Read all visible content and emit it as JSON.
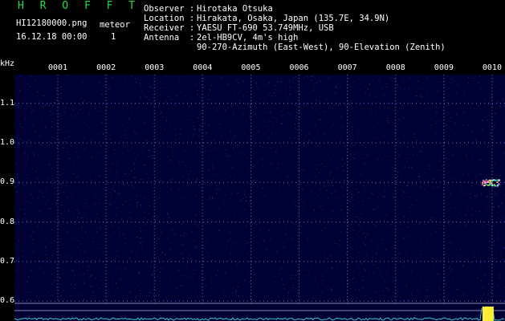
{
  "header": {
    "title": "H R O F F T",
    "filename": "HI12180000.png",
    "datetime": "16.12.18 00:00",
    "meteor_label": "meteor",
    "meteor_count": "1"
  },
  "station": {
    "observer_label": "Observer :",
    "observer_value": "Hirotaka Otsuka",
    "location_label": "Location :",
    "location_value": "Hirakata, Osaka, Japan (135.7E, 34.9N)",
    "receiver_label": "Receiver :",
    "receiver_value": "YAESU FT-690 53.749MHz, USB",
    "antenna_label": "Antenna  :",
    "antenna_value": "2el-HB9CV, 4m's high",
    "antenna_value_2": "90-270-Azimuth (East-West), 90-Elevation (Zenith)"
  },
  "spectrogram": {
    "y_unit": "kHz",
    "y_ticks": [
      "1.1",
      "1.0",
      "0.9",
      "0.8",
      "0.7",
      "0.6"
    ],
    "x_ticks": [
      "0001",
      "0002",
      "0003",
      "0004",
      "0005",
      "0006",
      "0007",
      "0008",
      "0009",
      "0010"
    ],
    "background_color": "#000033",
    "grid_color": "#6a6ad8",
    "meteor_echo": {
      "minute": 9.9,
      "frequency_khz": 0.9
    }
  }
}
